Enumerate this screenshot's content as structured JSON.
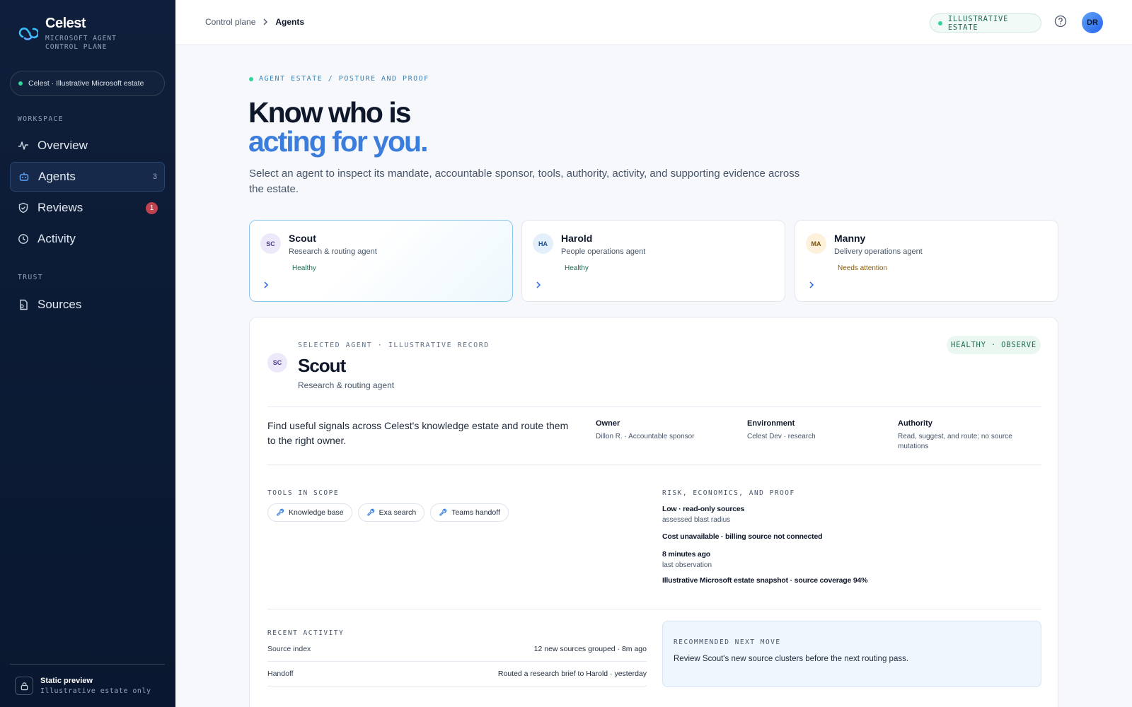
{
  "app": {
    "name": "Celest",
    "subtitle": "MICROSOFT AGENT CONTROL PLANE",
    "estate_label": "Celest · Illustrative Microsoft estate"
  },
  "sidebar": {
    "workspace_label": "WORKSPACE",
    "trust_label": "TRUST",
    "items": [
      {
        "label": "Overview",
        "icon": "activity-pulse-icon"
      },
      {
        "label": "Agents",
        "icon": "robot-icon",
        "count": "3",
        "active": true
      },
      {
        "label": "Reviews",
        "icon": "shield-check-icon",
        "badge": "1"
      },
      {
        "label": "Activity",
        "icon": "clock-icon"
      }
    ],
    "trust_items": [
      {
        "label": "Sources",
        "icon": "file-source-icon"
      }
    ],
    "footer": {
      "title": "Static preview",
      "subtitle": "Illustrative estate only",
      "icon": "lock-icon"
    }
  },
  "topbar": {
    "breadcrumb": [
      "Control plane",
      "Agents"
    ],
    "estate_badge": "ILLUSTRATIVE ESTATE",
    "user_initials": "DR"
  },
  "hero": {
    "eyebrow": "AGENT ESTATE / POSTURE AND PROOF",
    "title_line1": "Know who is",
    "title_line2": "acting for you.",
    "description": "Select an agent to inspect its mandate, accountable sponsor, tools, authority, activity, and supporting evidence across the estate."
  },
  "agents": [
    {
      "initials": "SC",
      "name": "Scout",
      "role": "Research & routing agent",
      "status": "Healthy",
      "selected": true
    },
    {
      "initials": "HA",
      "name": "Harold",
      "role": "People operations agent",
      "status": "Healthy"
    },
    {
      "initials": "MA",
      "name": "Manny",
      "role": "Delivery operations agent",
      "status": "Needs attention"
    }
  ],
  "detail": {
    "eyebrow": "SELECTED AGENT · ILLUSTRATIVE RECORD",
    "initials": "SC",
    "name": "Scout",
    "role": "Research & routing agent",
    "health": "HEALTHY · OBSERVE",
    "mandate": "Find useful signals across Celest's knowledge estate and route them to the right owner.",
    "facts": [
      {
        "label": "Owner",
        "value": "Dillon R. · Accountable sponsor"
      },
      {
        "label": "Environment",
        "value": "Celest Dev · research"
      },
      {
        "label": "Authority",
        "value": "Read, suggest, and route; no source mutations"
      }
    ],
    "tools_label": "TOOLS IN SCOPE",
    "tools": [
      "Knowledge base",
      "Exa search",
      "Teams handoff"
    ],
    "risk_label": "RISK, ECONOMICS, AND PROOF",
    "risk": [
      {
        "main": "Low · read-only sources",
        "sub": "assessed blast radius"
      },
      {
        "main": "Cost unavailable · billing source not connected",
        "sub": ""
      },
      {
        "main": "8 minutes ago",
        "sub": "last observation"
      },
      {
        "main": "Illustrative Microsoft estate snapshot · source coverage 94%",
        "sub": ""
      }
    ],
    "activity_label": "RECENT ACTIVITY",
    "activity": [
      {
        "source": "Source index",
        "event": "12 new sources grouped · 8m ago"
      },
      {
        "source": "Handoff",
        "event": "Routed a research brief to Harold · yesterday"
      }
    ],
    "next_move_label": "RECOMMENDED NEXT MOVE",
    "next_move": "Review Scout's new source clusters before the next routing pass."
  },
  "colors": {
    "sidebar_bg": "#0f1e3a",
    "accent_blue": "#3b7ddd",
    "healthy_green": "#1f6b52",
    "attention_amber": "#8a5a00",
    "alert_red": "#c0424f"
  }
}
